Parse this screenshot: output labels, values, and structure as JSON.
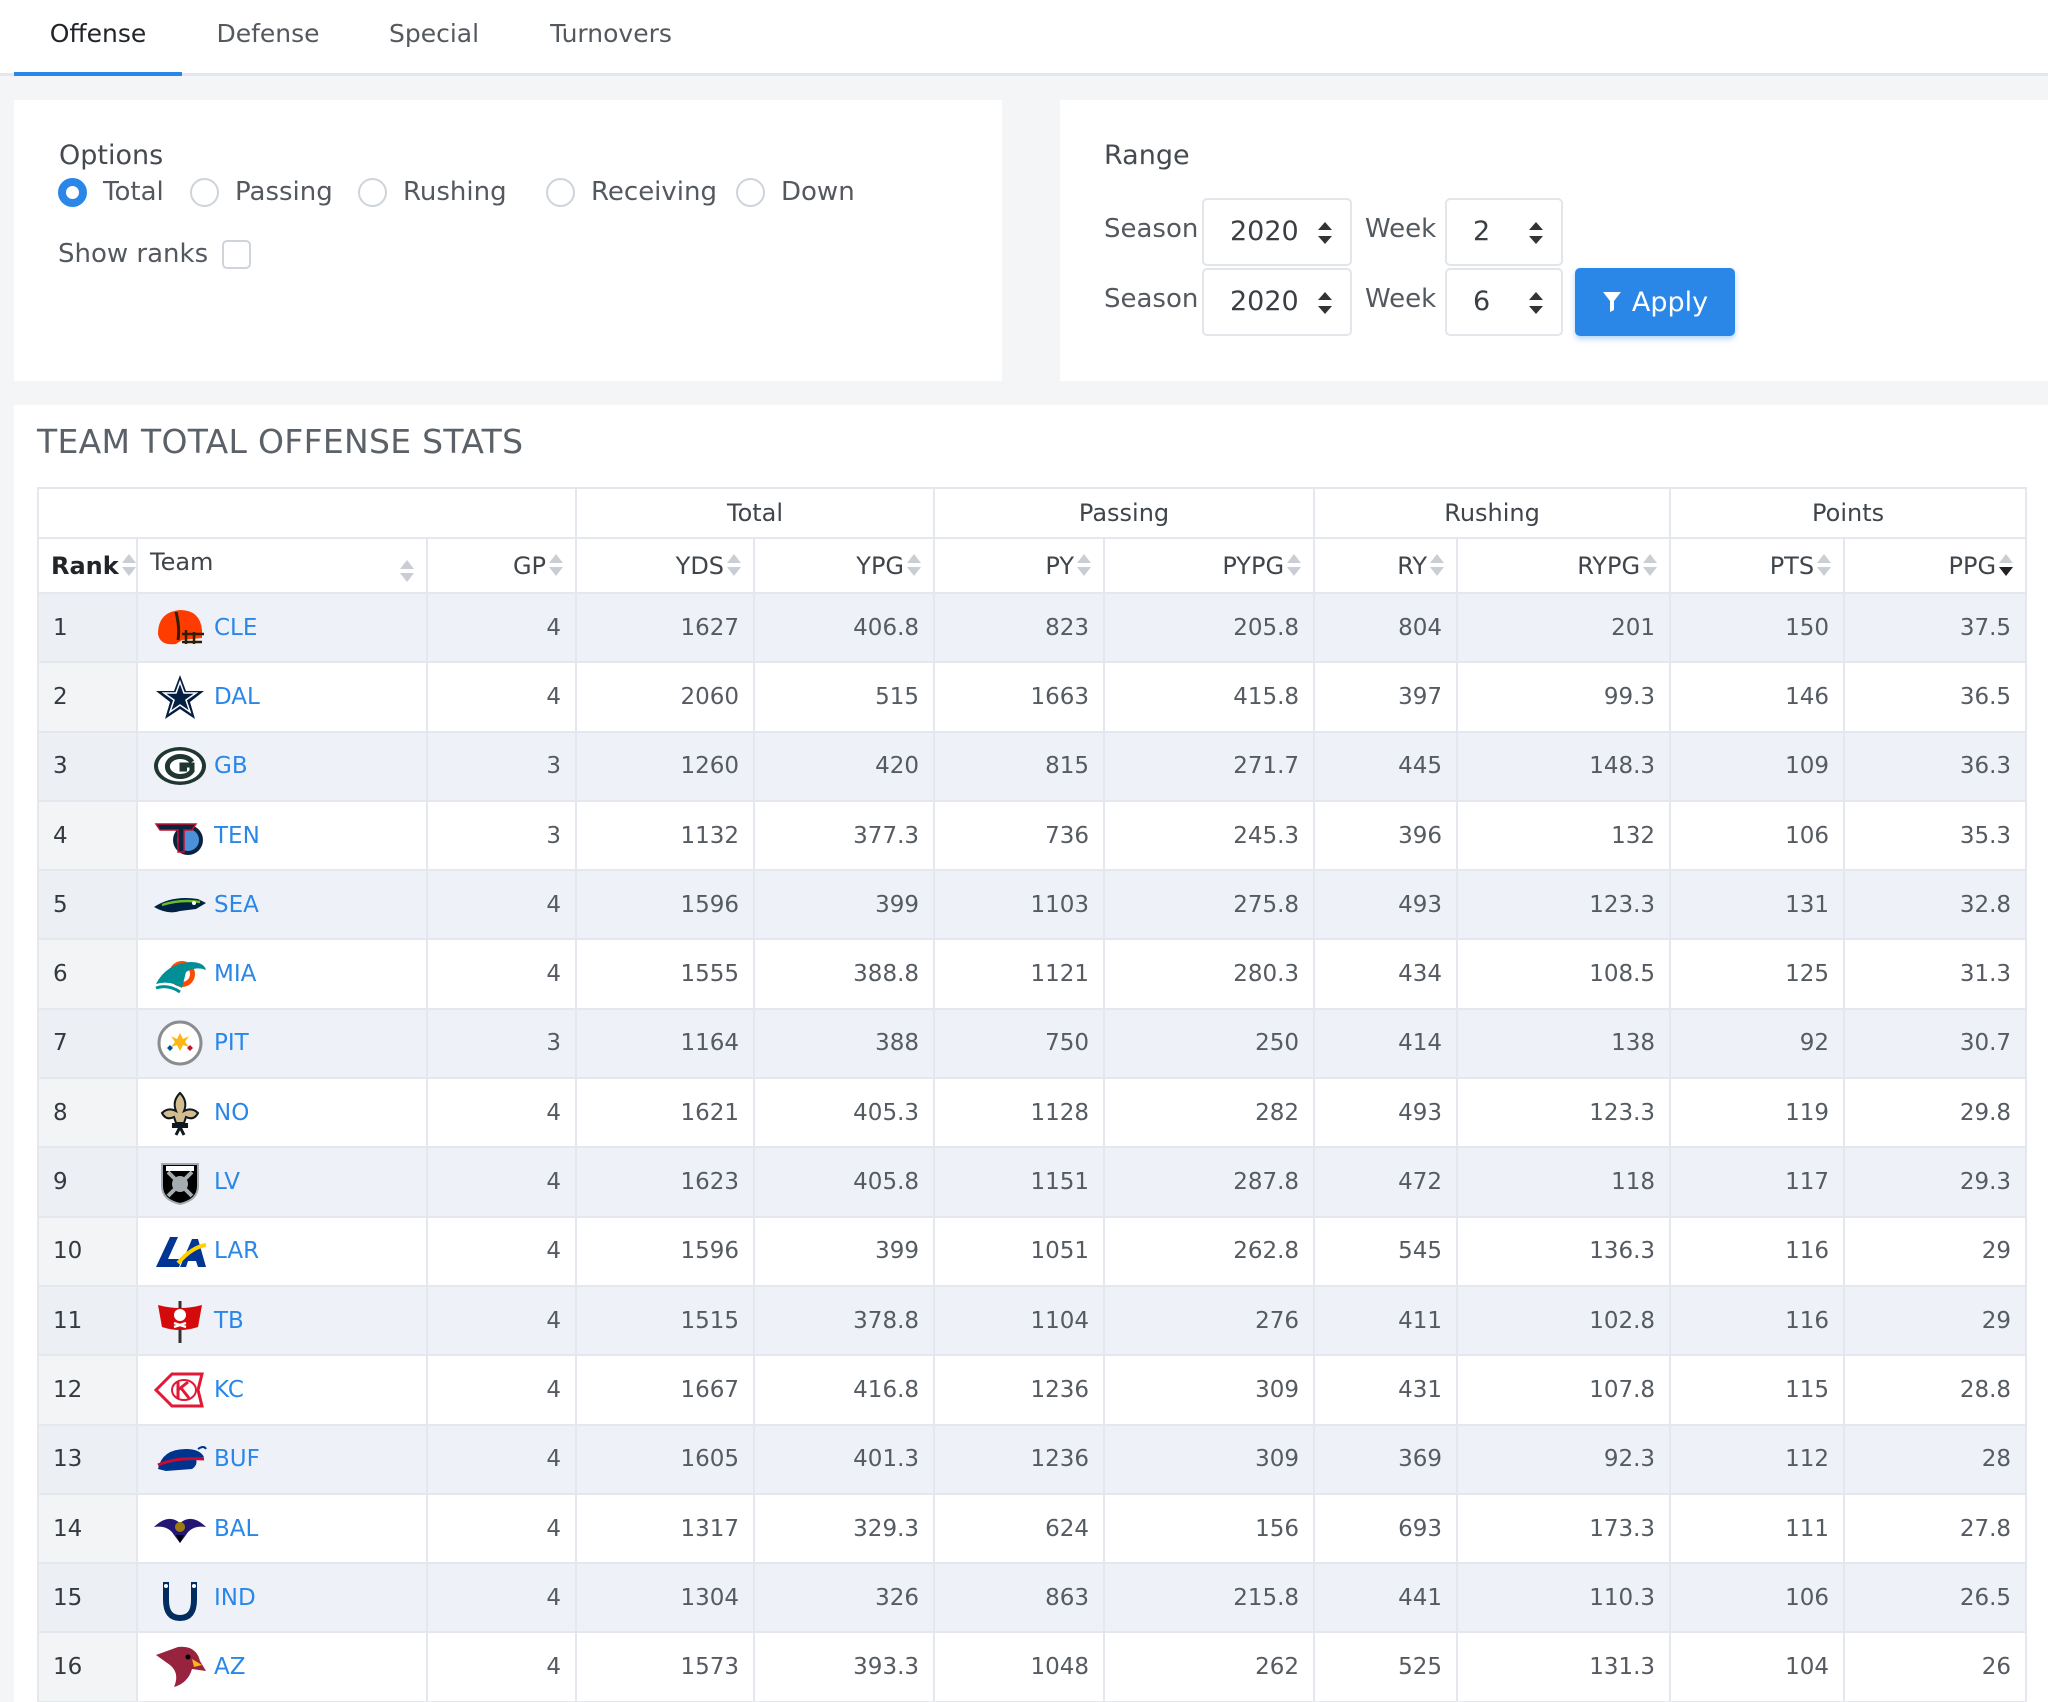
{
  "tabs": [
    "Offense",
    "Defense",
    "Special",
    "Turnovers"
  ],
  "options": {
    "title": "Options",
    "radios": [
      "Total",
      "Passing",
      "Rushing",
      "Receiving",
      "Down"
    ],
    "selected": "Total",
    "show_ranks_label": "Show ranks",
    "show_ranks_checked": false
  },
  "range": {
    "title": "Range",
    "season_label": "Season",
    "week_label": "Week",
    "start": {
      "season": "2020",
      "week": "2"
    },
    "end": {
      "season": "2020",
      "week": "6"
    },
    "apply_label": "Apply"
  },
  "stats": {
    "title": "TEAM TOTAL OFFENSE STATS",
    "groups": [
      "Total",
      "Passing",
      "Rushing",
      "Points"
    ],
    "columns": [
      "Rank",
      "Team",
      "GP",
      "YDS",
      "YPG",
      "PY",
      "PYPG",
      "RY",
      "RYPG",
      "PTS",
      "PPG"
    ],
    "sorted_column": "PPG",
    "rows": [
      [
        "1",
        "CLE",
        "4",
        "1627",
        "406.8",
        "823",
        "205.8",
        "804",
        "201",
        "150",
        "37.5"
      ],
      [
        "2",
        "DAL",
        "4",
        "2060",
        "515",
        "1663",
        "415.8",
        "397",
        "99.3",
        "146",
        "36.5"
      ],
      [
        "3",
        "GB",
        "3",
        "1260",
        "420",
        "815",
        "271.7",
        "445",
        "148.3",
        "109",
        "36.3"
      ],
      [
        "4",
        "TEN",
        "3",
        "1132",
        "377.3",
        "736",
        "245.3",
        "396",
        "132",
        "106",
        "35.3"
      ],
      [
        "5",
        "SEA",
        "4",
        "1596",
        "399",
        "1103",
        "275.8",
        "493",
        "123.3",
        "131",
        "32.8"
      ],
      [
        "6",
        "MIA",
        "4",
        "1555",
        "388.8",
        "1121",
        "280.3",
        "434",
        "108.5",
        "125",
        "31.3"
      ],
      [
        "7",
        "PIT",
        "3",
        "1164",
        "388",
        "750",
        "250",
        "414",
        "138",
        "92",
        "30.7"
      ],
      [
        "8",
        "NO",
        "4",
        "1621",
        "405.3",
        "1128",
        "282",
        "493",
        "123.3",
        "119",
        "29.8"
      ],
      [
        "9",
        "LV",
        "4",
        "1623",
        "405.8",
        "1151",
        "287.8",
        "472",
        "118",
        "117",
        "29.3"
      ],
      [
        "10",
        "LAR",
        "4",
        "1596",
        "399",
        "1051",
        "262.8",
        "545",
        "136.3",
        "116",
        "29"
      ],
      [
        "11",
        "TB",
        "4",
        "1515",
        "378.8",
        "1104",
        "276",
        "411",
        "102.8",
        "116",
        "29"
      ],
      [
        "12",
        "KC",
        "4",
        "1667",
        "416.8",
        "1236",
        "309",
        "431",
        "107.8",
        "115",
        "28.8"
      ],
      [
        "13",
        "BUF",
        "4",
        "1605",
        "401.3",
        "1236",
        "309",
        "369",
        "92.3",
        "112",
        "28"
      ],
      [
        "14",
        "BAL",
        "4",
        "1317",
        "329.3",
        "624",
        "156",
        "693",
        "173.3",
        "111",
        "27.8"
      ],
      [
        "15",
        "IND",
        "4",
        "1304",
        "326",
        "863",
        "215.8",
        "441",
        "110.3",
        "106",
        "26.5"
      ],
      [
        "16",
        "AZ",
        "4",
        "1573",
        "393.3",
        "1048",
        "262",
        "525",
        "131.3",
        "104",
        "26"
      ]
    ],
    "logos": {
      "CLE": {
        "icon": "browns-helmet-icon",
        "primary": "#FF3C00",
        "secondary": "#311D00"
      },
      "DAL": {
        "icon": "cowboys-star-icon",
        "primary": "#041E42",
        "secondary": "#869397"
      },
      "GB": {
        "icon": "packers-g-icon",
        "primary": "#203731",
        "secondary": "#FFB612"
      },
      "TEN": {
        "icon": "titans-t-icon",
        "primary": "#0C2340",
        "secondary": "#4B92DB"
      },
      "SEA": {
        "icon": "seahawks-head-icon",
        "primary": "#002244",
        "secondary": "#69BE28"
      },
      "MIA": {
        "icon": "dolphins-icon",
        "primary": "#008E97",
        "secondary": "#FC4C02"
      },
      "PIT": {
        "icon": "steelers-hypocycloids-icon",
        "primary": "#FFB612",
        "secondary": "#101820"
      },
      "NO": {
        "icon": "saints-fleur-de-lis-icon",
        "primary": "#D3BC8D",
        "secondary": "#101820"
      },
      "LV": {
        "icon": "raiders-shield-icon",
        "primary": "#000000",
        "secondary": "#A5ACAF"
      },
      "LAR": {
        "icon": "rams-la-icon",
        "primary": "#003594",
        "secondary": "#FFD100"
      },
      "TB": {
        "icon": "buccaneers-flag-icon",
        "primary": "#D50A0A",
        "secondary": "#34302B"
      },
      "KC": {
        "icon": "chiefs-arrowhead-icon",
        "primary": "#E31837",
        "secondary": "#FFB81C"
      },
      "BUF": {
        "icon": "bills-buffalo-icon",
        "primary": "#00338D",
        "secondary": "#C60C30"
      },
      "BAL": {
        "icon": "ravens-head-icon",
        "primary": "#241773",
        "secondary": "#9E7C0C"
      },
      "IND": {
        "icon": "colts-horseshoe-icon",
        "primary": "#002C5F",
        "secondary": "#A2AAAD"
      },
      "AZ": {
        "icon": "cardinals-head-icon",
        "primary": "#97233F",
        "secondary": "#FFB612"
      }
    }
  },
  "colors": {
    "accent": "#2a87e8",
    "link": "#2a87e8",
    "row_stripe": "#eef2f8"
  }
}
